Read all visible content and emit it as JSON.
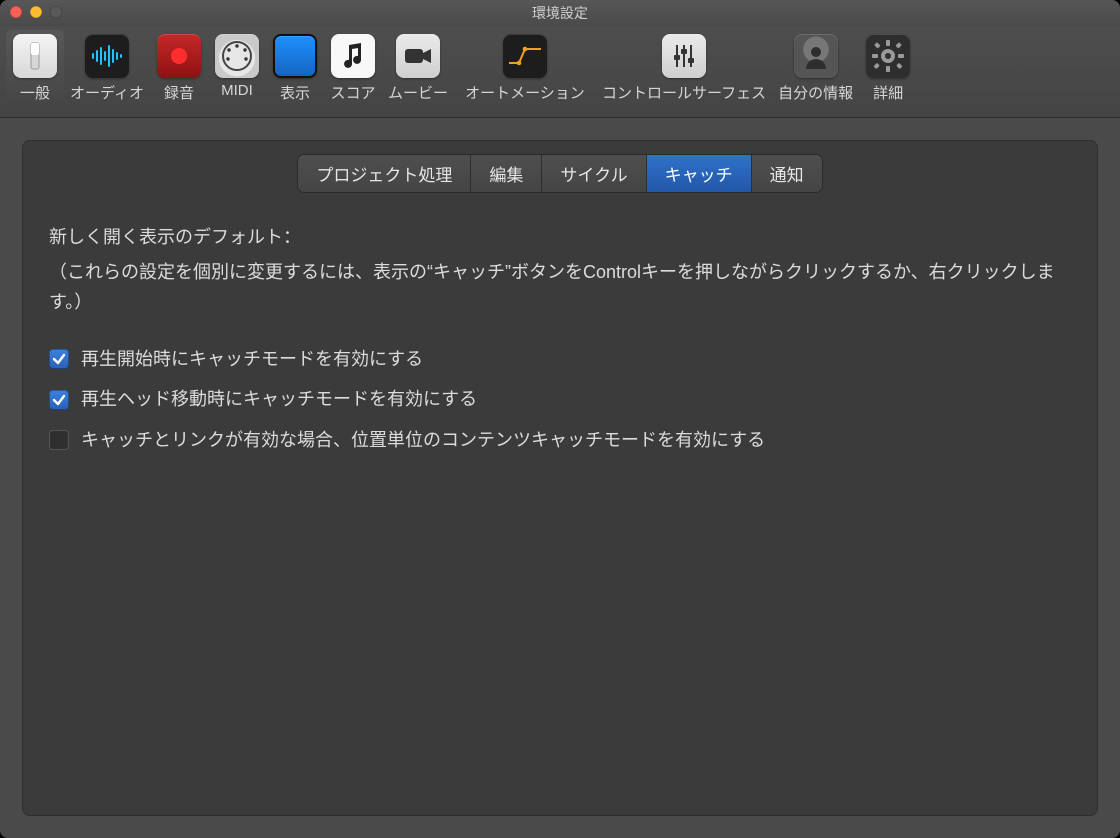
{
  "window": {
    "title": "環境設定"
  },
  "toolbar": {
    "items": [
      {
        "id": "general",
        "label": "一般",
        "selected": true
      },
      {
        "id": "audio",
        "label": "オーディオ",
        "selected": false
      },
      {
        "id": "record",
        "label": "録音",
        "selected": false
      },
      {
        "id": "midi",
        "label": "MIDI",
        "selected": false
      },
      {
        "id": "display",
        "label": "表示",
        "selected": false
      },
      {
        "id": "score",
        "label": "スコア",
        "selected": false
      },
      {
        "id": "movie",
        "label": "ムービー",
        "selected": false
      },
      {
        "id": "automation",
        "label": "オートメーション",
        "selected": false
      },
      {
        "id": "surfaces",
        "label": "コントロールサーフェス",
        "selected": false
      },
      {
        "id": "myinfo",
        "label": "自分の情報",
        "selected": false
      },
      {
        "id": "advanced",
        "label": "詳細",
        "selected": false
      }
    ]
  },
  "tabs": {
    "items": [
      {
        "id": "project",
        "label": "プロジェクト処理",
        "active": false
      },
      {
        "id": "edit",
        "label": "編集",
        "active": false
      },
      {
        "id": "cycle",
        "label": "サイクル",
        "active": false
      },
      {
        "id": "catch",
        "label": "キャッチ",
        "active": true
      },
      {
        "id": "notify",
        "label": "通知",
        "active": false
      }
    ]
  },
  "catch_pane": {
    "lead": "新しく開く表示のデフォルト：",
    "sub": "（これらの設定を個別に変更するには、表示の“キャッチ”ボタンをControlキーを押しながらクリックするか、右クリックします。）",
    "checkboxes": [
      {
        "id": "on_play_start",
        "label": "再生開始時にキャッチモードを有効にする",
        "checked": true
      },
      {
        "id": "on_playhead_move",
        "label": "再生ヘッド移動時にキャッチモードを有効にする",
        "checked": true
      },
      {
        "id": "content_catch",
        "label": "キャッチとリンクが有効な場合、位置単位のコンテンツキャッチモードを有効にする",
        "checked": false
      }
    ]
  }
}
